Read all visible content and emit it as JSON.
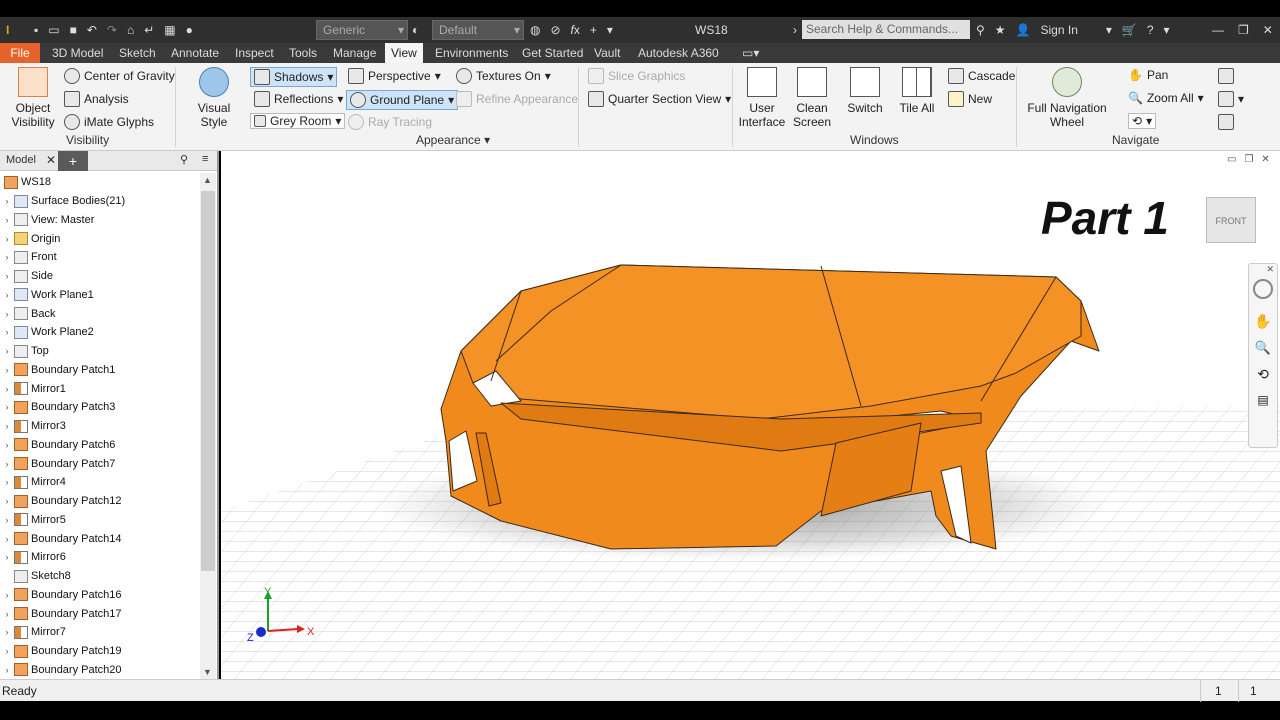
{
  "app": {
    "document_title": "WS18",
    "appearance_combo": "Generic",
    "material_combo": "Default",
    "search_placeholder": "Search Help & Commands...",
    "sign_in": "Sign In"
  },
  "tabs": [
    "File",
    "3D Model",
    "Sketch",
    "Annotate",
    "Inspect",
    "Tools",
    "Manage",
    "View",
    "Environments",
    "Get Started",
    "Vault",
    "Autodesk A360"
  ],
  "active_tab": "View",
  "ribbon": {
    "visibility": {
      "object_visibility": "Object\nVisibility",
      "center_of_gravity": "Center of Gravity",
      "analysis": "Analysis",
      "imate_glyphs": "iMate Glyphs",
      "panel": "Visibility"
    },
    "appearance": {
      "visual_style": "Visual Style",
      "shadows": "Shadows",
      "reflections": "Reflections",
      "grey_room": "Grey Room",
      "perspective": "Perspective",
      "ground_plane": "Ground Plane",
      "ray_tracing": "Ray Tracing",
      "textures_on": "Textures On",
      "refine_appearance": "Refine Appearance",
      "slice_graphics": "Slice Graphics",
      "quarter_section_view": "Quarter Section View",
      "panel": "Appearance"
    },
    "windows": {
      "user_interface": "User\nInterface",
      "clean_screen": "Clean\nScreen",
      "switch": "Switch",
      "tile_all": "Tile All",
      "cascade": "Cascade",
      "new": "New",
      "panel": "Windows"
    },
    "navigate": {
      "full_navigation_wheel": "Full Navigation\nWheel",
      "pan": "Pan",
      "zoom_all": "Zoom All",
      "panel": "Navigate"
    }
  },
  "browser": {
    "tab_label": "Model",
    "root": "WS18",
    "items": [
      {
        "label": "Surface Bodies(21)",
        "icon": "surface-bodies-icon"
      },
      {
        "label": "View: Master",
        "icon": "view-icon"
      },
      {
        "label": "Origin",
        "icon": "folder-icon"
      },
      {
        "label": "Front",
        "icon": "sketch-icon"
      },
      {
        "label": "Side",
        "icon": "sketch-icon"
      },
      {
        "label": "Work Plane1",
        "icon": "work-plane-icon"
      },
      {
        "label": "Back",
        "icon": "sketch-icon"
      },
      {
        "label": "Work Plane2",
        "icon": "work-plane-icon"
      },
      {
        "label": "Top",
        "icon": "sketch-icon"
      },
      {
        "label": "Boundary Patch1",
        "icon": "boundary-patch-icon"
      },
      {
        "label": "Mirror1",
        "icon": "mirror-icon"
      },
      {
        "label": "Boundary Patch3",
        "icon": "boundary-patch-icon"
      },
      {
        "label": "Mirror3",
        "icon": "mirror-icon"
      },
      {
        "label": "Boundary Patch6",
        "icon": "boundary-patch-icon"
      },
      {
        "label": "Boundary Patch7",
        "icon": "boundary-patch-icon"
      },
      {
        "label": "Mirror4",
        "icon": "mirror-icon"
      },
      {
        "label": "Boundary Patch12",
        "icon": "boundary-patch-icon"
      },
      {
        "label": "Mirror5",
        "icon": "mirror-icon"
      },
      {
        "label": "Boundary Patch14",
        "icon": "boundary-patch-icon"
      },
      {
        "label": "Mirror6",
        "icon": "mirror-icon"
      },
      {
        "label": "Sketch8",
        "icon": "sketch-icon"
      },
      {
        "label": "Boundary Patch16",
        "icon": "boundary-patch-icon"
      },
      {
        "label": "Boundary Patch17",
        "icon": "boundary-patch-icon"
      },
      {
        "label": "Mirror7",
        "icon": "mirror-icon"
      },
      {
        "label": "Boundary Patch19",
        "icon": "boundary-patch-icon"
      },
      {
        "label": "Boundary Patch20",
        "icon": "boundary-patch-icon"
      }
    ]
  },
  "viewport": {
    "overlay_title": "Part 1",
    "viewcube_face": "FRONT",
    "axis_x": "X",
    "axis_y": "Y",
    "axis_z": "Z"
  },
  "status": {
    "text": "Ready",
    "count_a": "1",
    "count_b": "1"
  },
  "colors": {
    "model": "#f08a1c",
    "ribbon_bg": "#f3f3f3",
    "file_tab": "#e8622c",
    "highlight": "#cde3f7"
  }
}
